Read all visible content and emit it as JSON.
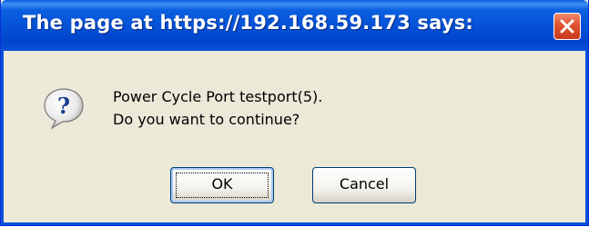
{
  "window": {
    "title": "The page at https://192.168.59.173 says:",
    "close_icon": "close-icon"
  },
  "dialog": {
    "icon": "question-icon",
    "message_lines": [
      "Power Cycle Port testport(5).",
      "Do you want to continue?"
    ],
    "buttons": {
      "ok_label": "OK",
      "cancel_label": "Cancel"
    }
  },
  "colors": {
    "titlebar": "#0450d6",
    "dialog_bg": "#ece9d8",
    "close_button": "#e0532f",
    "text": "#000000"
  }
}
